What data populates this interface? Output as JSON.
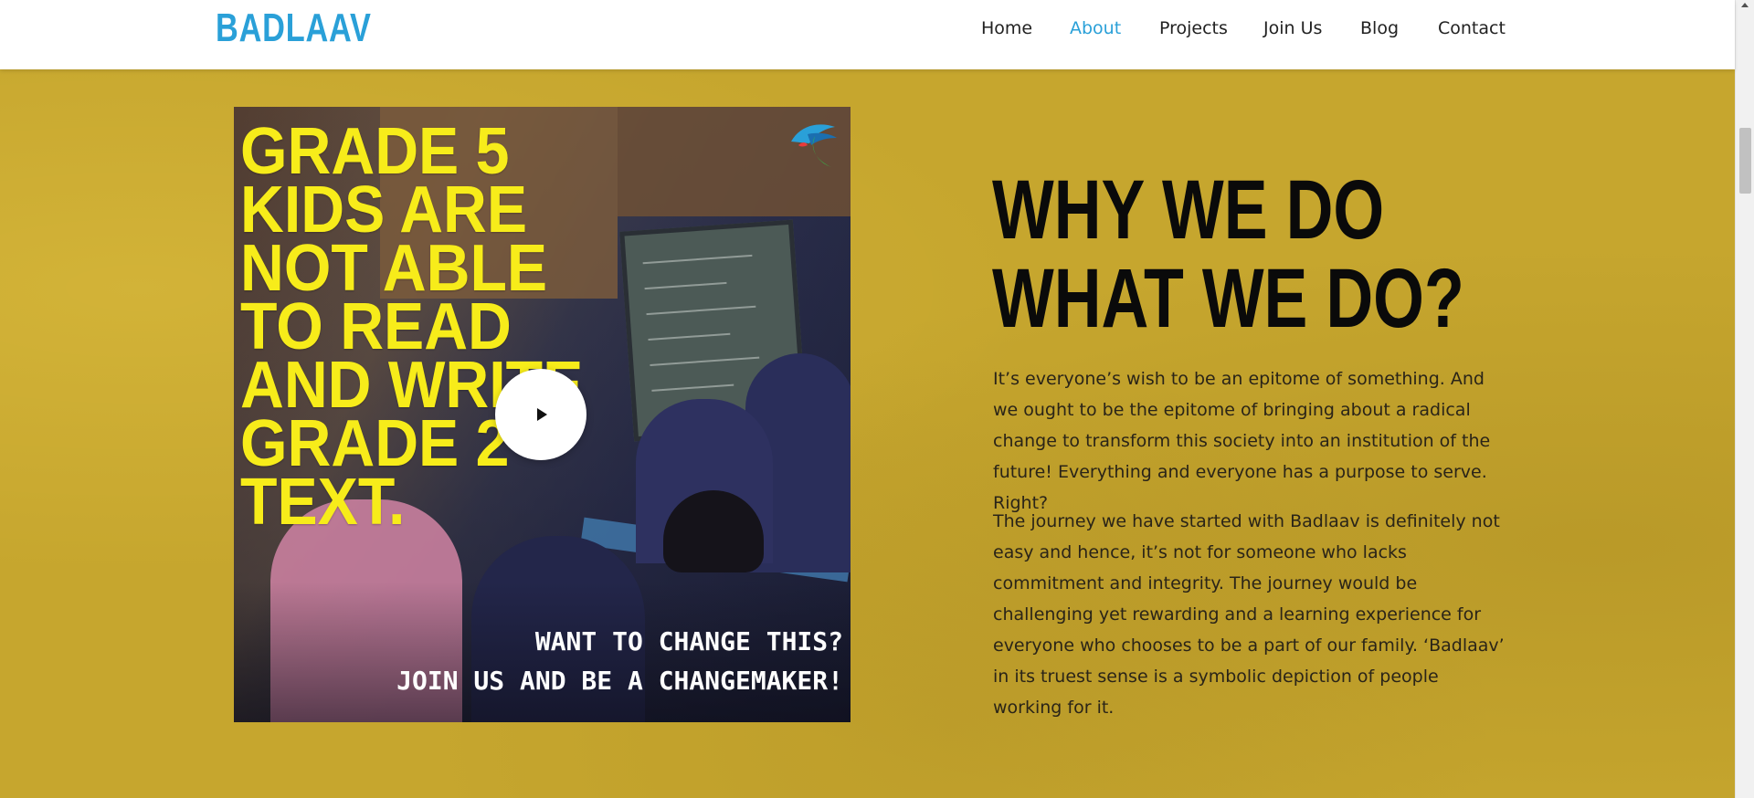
{
  "header": {
    "logo": "BADLAAV",
    "nav": [
      {
        "label": "Home",
        "active": false
      },
      {
        "label": "About",
        "active": true
      },
      {
        "label": "Projects",
        "active": false
      },
      {
        "label": "Join Us",
        "active": false
      },
      {
        "label": "Blog",
        "active": false
      },
      {
        "label": "Contact",
        "active": false
      }
    ]
  },
  "video": {
    "headline": "Grade 5\nKids are\nnot able\nto read\nand write\nGrade 2\ntext.",
    "cta_line1": "WANT TO CHANGE THIS?",
    "cta_line2": "JOIN US AND BE A CHANGEMAKER!",
    "play_icon": "play-icon",
    "badge_icon": "badlaav-emblem-icon"
  },
  "content": {
    "heading": "WHY WE DO WHAT WE DO?",
    "paragraph1": "It’s everyone’s wish to be an epitome of something. And we ought to be the epitome of bringing about a radical change to transform this society into an institution of the future! Everything and everyone has a purpose to serve. Right?",
    "paragraph2": "The journey we have started with Badlaav is definitely not easy and hence, it’s not for someone who lacks commitment and integrity. The journey would be challenging yet rewarding and a learning experience for everyone who chooses to be a part of our family. ‘Badlaav’ in its truest sense is a symbolic depiction of people working for it."
  },
  "colors": {
    "brand": "#2aa0d8",
    "section_bg": "#c6a62e",
    "headline_yellow": "#f7ec1a",
    "heading_text": "#0a0a0a"
  }
}
